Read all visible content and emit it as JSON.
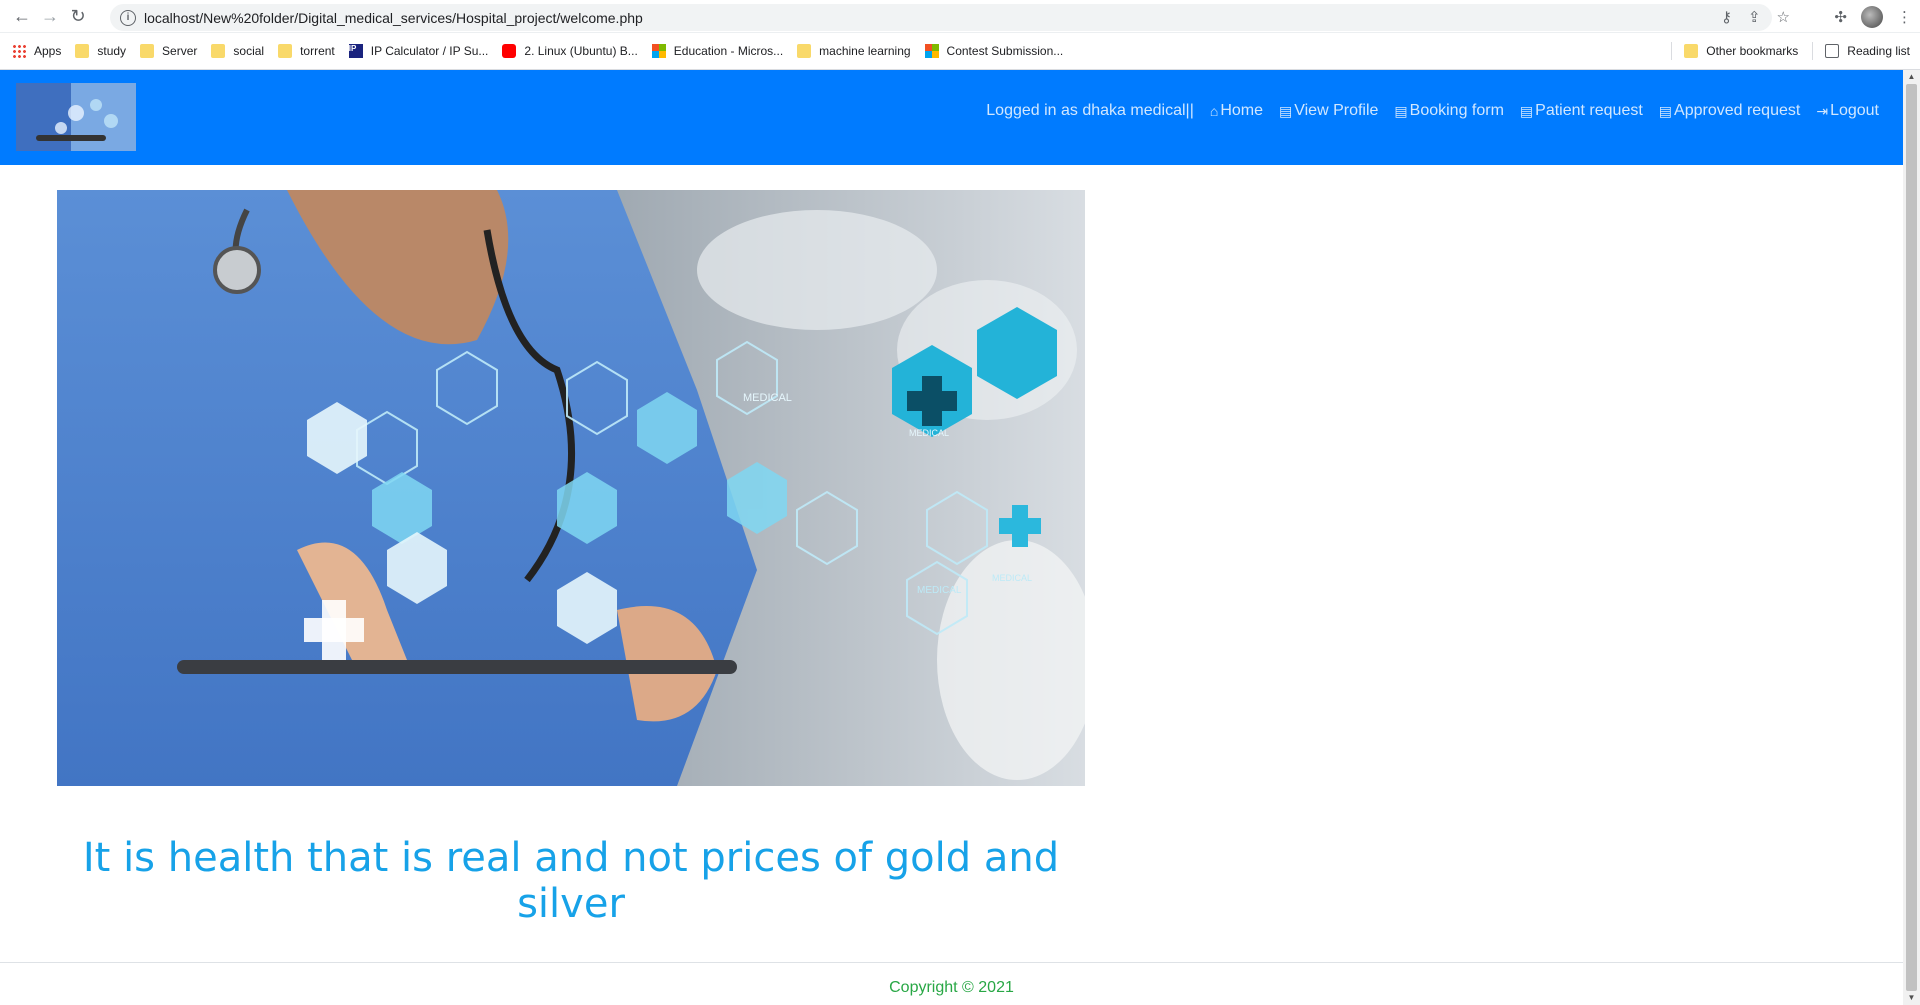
{
  "browser": {
    "url": "localhost/New%20folder/Digital_medical_services/Hospital_project/welcome.php",
    "bookmarks": [
      "Apps",
      "study",
      "Server",
      "social",
      "torrent",
      "IP Calculator / IP Su...",
      "2. Linux (Ubuntu) B...",
      "Education - Micros...",
      "machine learning",
      "Contest Submission..."
    ],
    "other_bookmarks": "Other bookmarks",
    "reading_list": "Reading list"
  },
  "navbar": {
    "logged_in": "Logged in as dhaka medical||",
    "links": [
      "Home",
      "View Profile",
      "Booking form",
      "Patient request",
      "Approved request",
      "Logout"
    ]
  },
  "hero": {
    "hex_labels": [
      "MEDICAL",
      "MEDICAL",
      "MEDICAL",
      "MEDICAL"
    ]
  },
  "quote": "It is health that is real and not prices of gold and silver",
  "footer": "Copyright © 2021",
  "colors": {
    "navbar": "#007bff",
    "quote": "#17a2e8",
    "footer_text": "#28a745"
  }
}
